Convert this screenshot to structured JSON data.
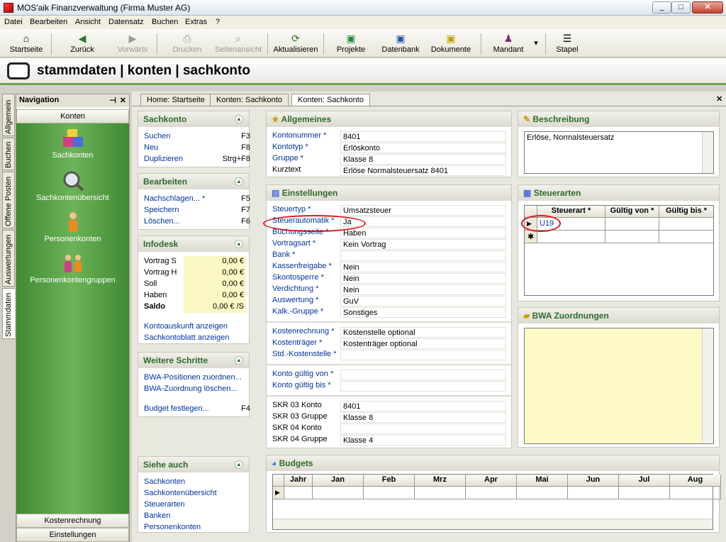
{
  "window": {
    "title": "MOS'aik Finanzverwaltung (Firma Muster AG)",
    "min": "_",
    "max": "□",
    "close": "✕"
  },
  "menu": [
    "Datei",
    "Bearbeiten",
    "Ansicht",
    "Datensatz",
    "Buchen",
    "Extras",
    "?"
  ],
  "toolbar": {
    "startseite": "Startseite",
    "zurueck": "Zurück",
    "vorwaerts": "Vorwärts",
    "drucken": "Drucken",
    "seitenansicht": "Seitenansicht",
    "aktualisieren": "Aktualisieren",
    "projekte": "Projekte",
    "datenbank": "Datenbank",
    "dokumente": "Dokumente",
    "mandant": "Mandant",
    "stapel": "Stapel"
  },
  "header": {
    "title": "stammdaten | konten | sachkonto"
  },
  "vtabs": [
    "Allgemein",
    "Buchen",
    "Offene Posten",
    "Auswertungen",
    "Stammdaten"
  ],
  "nav": {
    "title": "Navigation",
    "pin": "⊣",
    "close": "✕",
    "group": "Konten",
    "items": [
      "Sachkonten",
      "Sachkontenübersicht",
      "Personenkonten",
      "Personenkontengruppen"
    ],
    "bottom": [
      "Kostenrechnung",
      "Einstellungen"
    ]
  },
  "tabs": [
    "Home: Startseite",
    "Konten: Sachkonto",
    "Konten: Sachkonto"
  ],
  "tabclose": "✕",
  "sachkonto": {
    "title": "Sachkonto",
    "rows": [
      [
        "Suchen",
        "F3"
      ],
      [
        "Neu",
        "F8"
      ],
      [
        "Duplizieren",
        "Strg+F8"
      ]
    ]
  },
  "bearbeiten": {
    "title": "Bearbeiten",
    "rows": [
      [
        "Nachschlagen... *",
        "F5"
      ],
      [
        "Speichern",
        "F7"
      ],
      [
        "Löschen...",
        "F6"
      ]
    ]
  },
  "infodesk": {
    "title": "Infodesk",
    "rows": [
      [
        "Vortrag S",
        "0,00 €"
      ],
      [
        "Vortrag H",
        "0,00 €"
      ],
      [
        "Soll",
        "0,00 €"
      ],
      [
        "Haben",
        "0,00 €"
      ],
      [
        "Saldo",
        "0,00 € /S"
      ]
    ],
    "links": [
      "Kontoauskunft anzeigen",
      "Sachkontoblatt anzeigen"
    ]
  },
  "weitere": {
    "title": "Weitere Schritte",
    "rows": [
      [
        "BWA-Positionen zuordnen...",
        ""
      ],
      [
        "BWA-Zuordnung löschen...",
        ""
      ],
      [
        "Budget festlegen...",
        "F4"
      ]
    ]
  },
  "siehe": {
    "title": "Siehe auch",
    "links": [
      "Sachkonten",
      "Sachkontenübersicht",
      "Steuerarten",
      "Banken",
      "Personenkonten"
    ]
  },
  "allgemeines": {
    "title": "Allgemeines",
    "fields": [
      [
        "Kontonummer *",
        "8401"
      ],
      [
        "Kontotyp *",
        "Erlöskonto"
      ],
      [
        "Gruppe *",
        "Klasse 8"
      ],
      [
        "Kurztext",
        "Erlöse Normalsteuersatz 8401"
      ]
    ]
  },
  "einstellungen": {
    "title": "Einstellungen",
    "fields1": [
      [
        "Steuertyp *",
        "Umsatzsteuer"
      ],
      [
        "Steuerautomatik *",
        "Ja"
      ],
      [
        "Buchungsseite *",
        "Haben"
      ],
      [
        "Vortragsart *",
        "Kein Vortrag"
      ],
      [
        "Bank *",
        ""
      ],
      [
        "Kassenfreigabe *",
        "Nein"
      ],
      [
        "Skontosperre *",
        "Nein"
      ],
      [
        "Verdichtung *",
        "Nein"
      ],
      [
        "Auswertung *",
        "GuV"
      ],
      [
        "Kalk.-Gruppe *",
        "Sonstiges"
      ]
    ],
    "fields2": [
      [
        "Kostenrechnung *",
        "Kostenstelle optional"
      ],
      [
        "Kostenträger *",
        "Kostenträger optional"
      ],
      [
        "Std.-Kostenstelle *",
        ""
      ]
    ],
    "fields3": [
      [
        "Konto gültig von *",
        ""
      ],
      [
        "Konto gültig bis *",
        ""
      ]
    ],
    "fields4": [
      [
        "SKR 03 Konto",
        "8401"
      ],
      [
        "SKR 03 Gruppe",
        "Klasse 8"
      ],
      [
        "SKR 04 Konto",
        ""
      ],
      [
        "SKR 04 Gruppe",
        "Klasse 4"
      ]
    ]
  },
  "beschreibung": {
    "title": "Beschreibung",
    "text": "Erlöse, Normalsteuersatz"
  },
  "steuerarten": {
    "title": "Steuerarten",
    "headers": [
      "Steuerart *",
      "Gültig von *",
      "Gültig bis *"
    ],
    "rows": [
      [
        "U19",
        "",
        ""
      ]
    ],
    "newrow": "✱",
    "rowmark": "▶"
  },
  "bwa": {
    "title": "BWA Zuordnungen"
  },
  "budgets": {
    "title": "Budgets",
    "headers": [
      "Jahr",
      "Jan",
      "Feb",
      "Mrz",
      "Apr",
      "Mai",
      "Jun",
      "Jul",
      "Aug"
    ]
  }
}
